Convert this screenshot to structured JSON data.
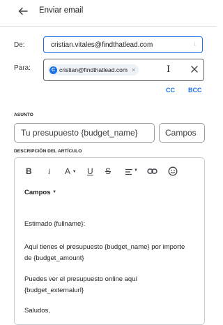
{
  "header": {
    "title": "Enviar email",
    "back_icon": "arrow-left-icon"
  },
  "from": {
    "label": "De:",
    "value": "cristian.vitales@findthatlead.com",
    "arrow": "↓"
  },
  "to": {
    "label": "Para:",
    "chip": {
      "avatar_letter": "C",
      "email": "cristian@findthatlead.com",
      "remove": "×"
    },
    "clear_icon": "close-icon"
  },
  "cc_label": "CC",
  "bcc_label": "BCC",
  "subject": {
    "section_label": "ASUNTO",
    "value": "Tu presupuesto {budget_name}",
    "campos_button": "Campos"
  },
  "description": {
    "section_label": "DESCRIPCIÓN DEL ARTÍCULO",
    "toolbar": {
      "bold": "B",
      "italic": "i",
      "font_size": "A",
      "underline": "U",
      "strike": "S"
    },
    "campos_dropdown": "Campos",
    "lines": [
      "Estimado {fullname}:",
      "Aquí tienes el presupuesto {budget_name} por importe",
      "de {budget_amount}",
      "Puedes ver el presupuesto online aquí",
      "{budget_externalurl}",
      "Saludos,"
    ]
  },
  "colors": {
    "accent": "#1a73e8",
    "text": "#202124",
    "border": "#9aa0a6"
  }
}
